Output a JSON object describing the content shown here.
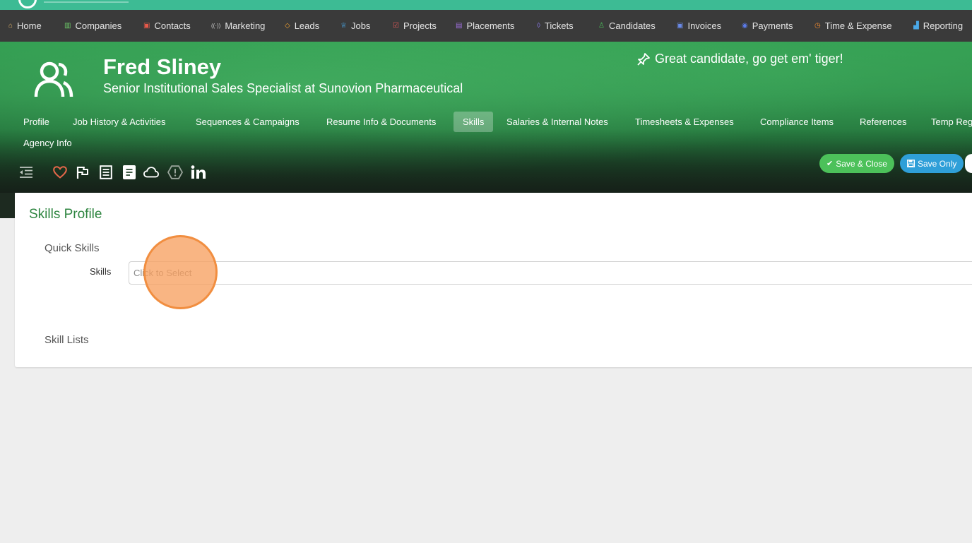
{
  "nav": {
    "items": [
      {
        "label": "Home",
        "icon": "house-icon",
        "glyph": "⌂",
        "color": "#e8b86b"
      },
      {
        "label": "Companies",
        "icon": "building-icon",
        "glyph": "▥",
        "color": "#6fcf6a"
      },
      {
        "label": "Contacts",
        "icon": "contact-card-icon",
        "glyph": "▣",
        "color": "#e8594a"
      },
      {
        "label": "Marketing",
        "icon": "broadcast-icon",
        "glyph": "((·))",
        "color": "#cfcfcf"
      },
      {
        "label": "Leads",
        "icon": "diamond-icon",
        "glyph": "◇",
        "color": "#f0a030"
      },
      {
        "label": "Jobs",
        "icon": "trophy-icon",
        "glyph": "♕",
        "color": "#4aa8e8"
      },
      {
        "label": "Projects",
        "icon": "checkbox-icon",
        "glyph": "☑",
        "color": "#e85a5a"
      },
      {
        "label": "Placements",
        "icon": "briefcase-icon",
        "glyph": "▤",
        "color": "#a070e0"
      },
      {
        "label": "Tickets",
        "icon": "tag-icon",
        "glyph": "◊",
        "color": "#8a78e8"
      },
      {
        "label": "Candidates",
        "icon": "person-icon",
        "glyph": "♙",
        "color": "#4cc15a"
      },
      {
        "label": "Invoices",
        "icon": "invoice-icon",
        "glyph": "▣",
        "color": "#6a8ae8"
      },
      {
        "label": "Payments",
        "icon": "coins-icon",
        "glyph": "◉",
        "color": "#5a7ae8"
      },
      {
        "label": "Time & Expense",
        "icon": "clock-icon",
        "glyph": "◷",
        "color": "#f08a30"
      },
      {
        "label": "Reporting",
        "icon": "bar-chart-icon",
        "glyph": "▟",
        "color": "#4aa8e8"
      }
    ]
  },
  "candidate": {
    "name": "Fred Sliney",
    "title": "Senior Institutional Sales Specialist at Sunovion Pharmaceutical",
    "pinned_note": "Great candidate, go get em' tiger!"
  },
  "tabs": [
    {
      "label": "Profile",
      "active": false
    },
    {
      "label": "Job History & Activities",
      "active": false
    },
    {
      "label": "Sequences & Campaigns",
      "active": false
    },
    {
      "label": "Resume Info & Documents",
      "active": false
    },
    {
      "label": "Skills",
      "active": true
    },
    {
      "label": "Salaries & Internal Notes",
      "active": false
    },
    {
      "label": "Timesheets & Expenses",
      "active": false
    },
    {
      "label": "Compliance Items",
      "active": false
    },
    {
      "label": "References",
      "active": false
    },
    {
      "label": "Temp Reg",
      "active": false
    },
    {
      "label": "Agency Info",
      "active": false
    }
  ],
  "toolbar": {
    "icons": [
      "collapse-menu-icon",
      "heart-icon",
      "flag-icon",
      "document-icon",
      "notes-icon",
      "cloud-icon",
      "warning-hexagon-icon",
      "linkedin-icon"
    ],
    "heart_color": "#e8684a"
  },
  "actions": {
    "save_close_label": "Save & Close",
    "save_only_label": "Save Only"
  },
  "skills": {
    "card_title": "Skills Profile",
    "quick_skills_heading": "Quick Skills",
    "skills_label": "Skills",
    "skills_placeholder": "Click to Select",
    "skill_lists_heading": "Skill Lists"
  }
}
